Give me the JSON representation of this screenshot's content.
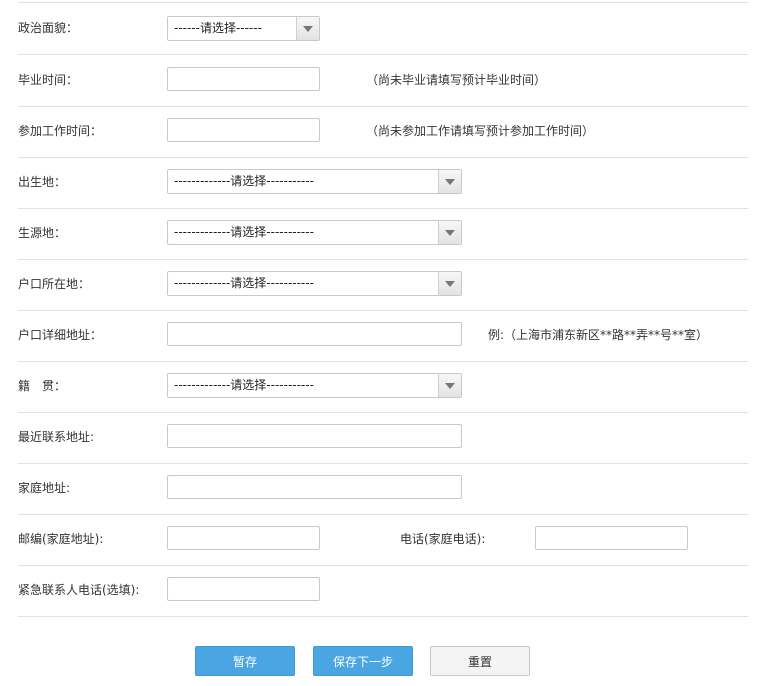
{
  "form": {
    "political": {
      "label": "政治面貌：",
      "selected": "------请选择------"
    },
    "graduation": {
      "label": "毕业时间：",
      "value": "",
      "hint": "（尚未毕业请填写预计毕业时间）"
    },
    "work_start": {
      "label": "参加工作时间：",
      "value": "",
      "hint": "（尚未参加工作请填写预计参加工作时间）"
    },
    "birthplace": {
      "label": "出生地：",
      "selected": "-------------请选择-----------"
    },
    "origin": {
      "label": "生源地：",
      "selected": "-------------请选择-----------"
    },
    "hukou": {
      "label": "户口所在地：",
      "selected": "-------------请选择-----------"
    },
    "hukou_address": {
      "label": "户口详细地址：",
      "value": "",
      "hint": "例:（上海市浦东新区**路**弄**号**室）"
    },
    "native_place": {
      "label": "籍　贯：",
      "selected": "-------------请选择-----------"
    },
    "recent_address": {
      "label": "最近联系地址:",
      "value": ""
    },
    "home_address": {
      "label": "家庭地址:",
      "value": ""
    },
    "postcode": {
      "label": "邮编(家庭地址):",
      "value": ""
    },
    "home_phone": {
      "label": "电话(家庭电话):",
      "value": ""
    },
    "emergency_phone": {
      "label": "紧急联系人电话(选填):",
      "value": ""
    }
  },
  "buttons": {
    "save_draft": "暂存",
    "save_next": "保存下一步",
    "reset": "重置"
  }
}
